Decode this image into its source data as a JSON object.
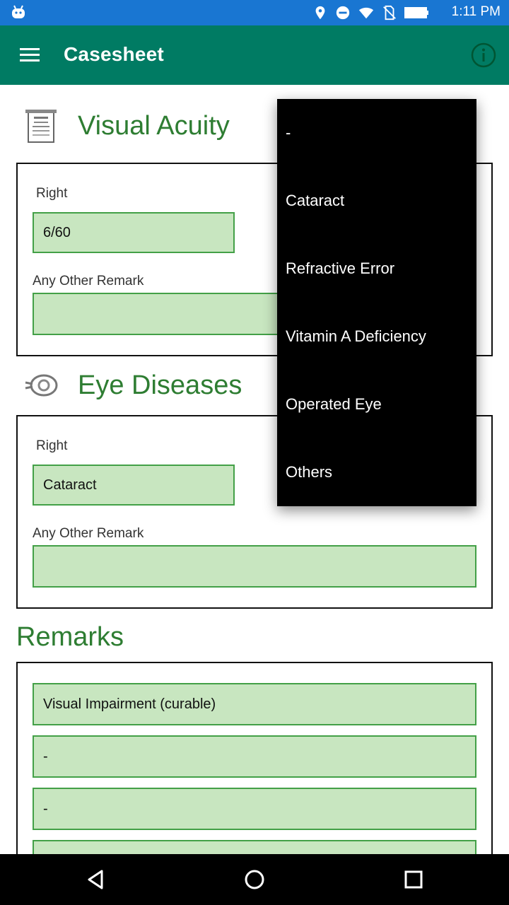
{
  "status_bar": {
    "time": "1:11 PM",
    "color": "#1976d2"
  },
  "app_bar": {
    "title": "Casesheet",
    "color": "#007b63"
  },
  "visual_acuity": {
    "heading": "Visual Acuity",
    "right_label": "Right",
    "right_value": "6/60",
    "remark_label": "Any Other Remark",
    "remark_value": ""
  },
  "eye_diseases": {
    "heading": "Eye Diseases",
    "right_label": "Right",
    "right_value": "Cataract",
    "remark_label": "Any Other Remark",
    "remark_value": ""
  },
  "remarks": {
    "heading": "Remarks",
    "values": [
      "Visual Impairment (curable)",
      "-",
      "-",
      ""
    ]
  },
  "dropdown": {
    "options": [
      "-",
      "Cataract",
      "Refractive Error",
      "Vitamin A Deficiency",
      "Operated Eye",
      "Others"
    ]
  },
  "colors": {
    "accent_green": "#2e7d32",
    "field_fill": "#c8e6c0",
    "field_border": "#43a047"
  },
  "icons": [
    "android-debug-icon",
    "location-icon",
    "do-not-disturb-icon",
    "wifi-icon",
    "no-sim-icon",
    "battery-icon",
    "menu-icon",
    "info-icon",
    "eye-chart-icon",
    "eye-icon",
    "back-icon",
    "home-icon",
    "recents-icon"
  ]
}
